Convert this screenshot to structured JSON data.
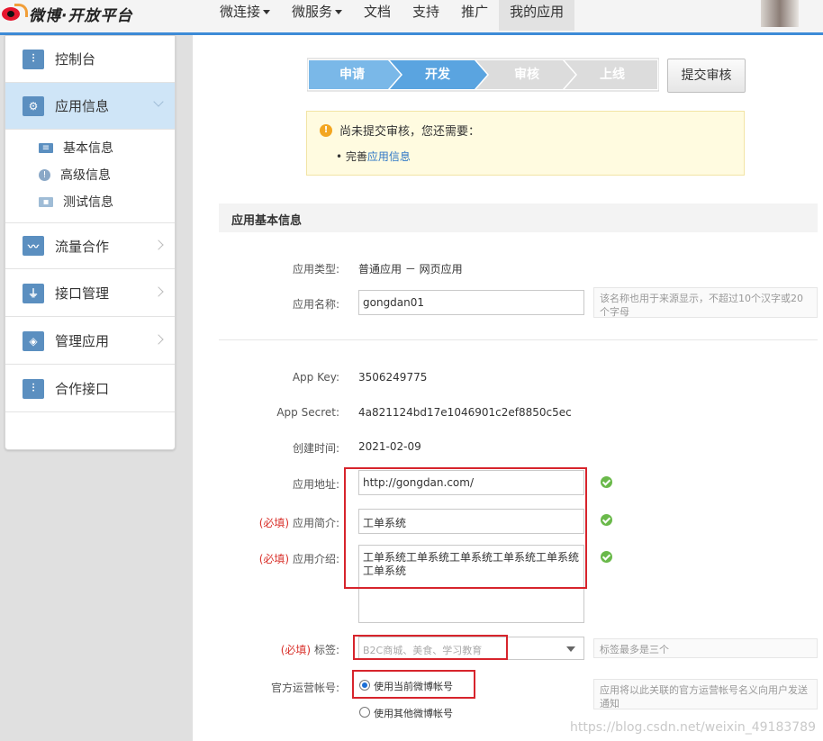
{
  "brand": {
    "name": "微博·开放平台"
  },
  "nav": {
    "items": [
      {
        "label": "微连接",
        "caret": true
      },
      {
        "label": "微服务",
        "caret": true
      },
      {
        "label": "文档",
        "caret": false
      },
      {
        "label": "支持",
        "caret": false
      },
      {
        "label": "推广",
        "caret": false
      },
      {
        "label": "我的应用",
        "caret": false,
        "active": true
      }
    ]
  },
  "sidebar": {
    "items": [
      {
        "label": "控制台",
        "icon": "sliders-icon"
      },
      {
        "label": "应用信息",
        "icon": "gear-icon",
        "active": true
      },
      {
        "label": "流量合作",
        "icon": "chart-icon"
      },
      {
        "label": "接口管理",
        "icon": "plug-icon"
      },
      {
        "label": "管理应用",
        "icon": "layers-icon"
      },
      {
        "label": "合作接口",
        "icon": "sliders-icon"
      }
    ],
    "subitems": [
      {
        "label": "基本信息",
        "icon": "id-card-icon"
      },
      {
        "label": "高级信息",
        "icon": "info-circle-icon"
      },
      {
        "label": "测试信息",
        "icon": "user-card-icon"
      }
    ]
  },
  "steps": [
    "申请",
    "开发",
    "审核",
    "上线"
  ],
  "submit_button": "提交审核",
  "notice": {
    "title": "尚未提交审核，您还需要：",
    "bullet_prefix": "完善",
    "bullet_link": "应用信息"
  },
  "section": {
    "title": "应用基本信息"
  },
  "form": {
    "app_type": {
      "label": "应用类型:",
      "value": "普通应用 － 网页应用"
    },
    "app_name": {
      "label": "应用名称:",
      "value": "gongdan01",
      "hint": "该名称也用于来源显示，不超过10个汉字或20个字母"
    },
    "app_key": {
      "label": "App Key:",
      "value": "3506249775"
    },
    "app_secret": {
      "label": "App Secret:",
      "value": "4a821124bd17e1046901c2ef8850c5ec"
    },
    "created": {
      "label": "创建时间:",
      "value": "2021-02-09"
    },
    "app_url": {
      "label": "应用地址:",
      "value": "http://gongdan.com/"
    },
    "app_summary": {
      "required": "(必填)",
      "label": "应用简介:",
      "value": "工单系统"
    },
    "app_intro": {
      "required": "(必填)",
      "label": "应用介绍:",
      "value": "工单系统工单系统工单系统工单系统工单系统工单系统"
    },
    "tags": {
      "required": "(必填)",
      "label": "标签:",
      "placeholder": "B2C商城、美食、学习教育",
      "hint": "标签最多是三个"
    },
    "official_account": {
      "label": "官方运营帐号:",
      "option_current": "使用当前微博帐号",
      "option_other": "使用其他微博帐号",
      "hint": "应用将以此关联的官方运营帐号名义向用户发送通知"
    }
  },
  "watermark": "https://blog.csdn.net/weixin_49183789"
}
